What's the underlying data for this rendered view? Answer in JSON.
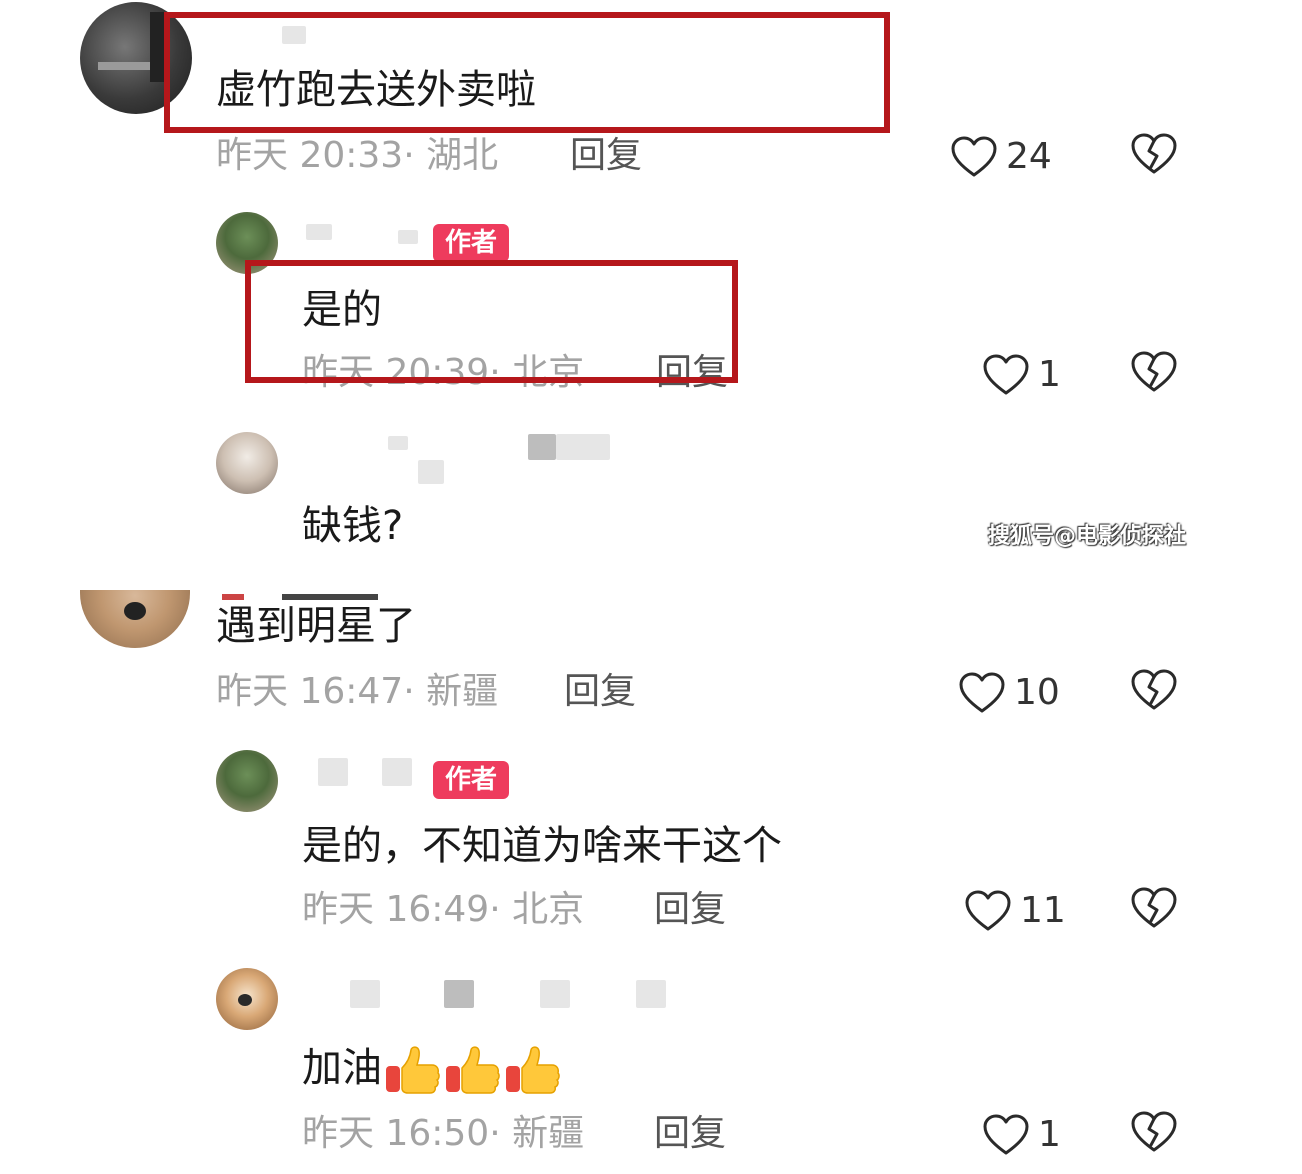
{
  "comments": [
    {
      "text": "虚竹跑去送外卖啦",
      "time": "昨天 20:33",
      "location": "· 湖北",
      "reply": "回复",
      "likes": "24"
    },
    {
      "badge": "作者",
      "text": "是的",
      "time": "昨天 20:39",
      "location": "· 北京",
      "reply": "回复",
      "likes": "1"
    },
    {
      "text": "缺钱?"
    },
    {
      "text": "遇到明星了",
      "time": "昨天 16:47",
      "location": "· 新疆",
      "reply": "回复",
      "likes": "10"
    },
    {
      "badge": "作者",
      "text": "是的，不知道为啥来干这个",
      "time": "昨天 16:49",
      "location": "· 北京",
      "reply": "回复",
      "likes": "11"
    },
    {
      "text": "加油",
      "emoji": [
        "thumbs-up",
        "thumbs-up",
        "thumbs-up"
      ],
      "time": "昨天 16:50",
      "location": "· 新疆",
      "reply": "回复",
      "likes": "1"
    }
  ],
  "watermark": "搜狐号@电影侦探社",
  "colors": {
    "badge": "#ee3b5d",
    "highlight_box": "#b5171b",
    "meta_text": "#a3a3a3"
  }
}
